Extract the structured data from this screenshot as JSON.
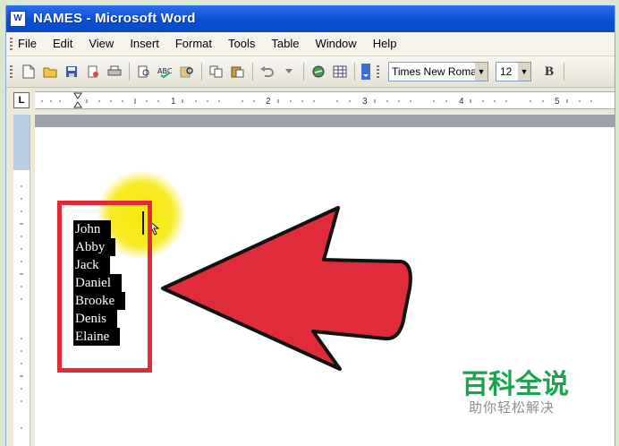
{
  "window": {
    "title": "NAMES - Microsoft Word",
    "app_icon": "W"
  },
  "menu": [
    {
      "label": "File"
    },
    {
      "label": "Edit"
    },
    {
      "label": "View"
    },
    {
      "label": "Insert"
    },
    {
      "label": "Format"
    },
    {
      "label": "Tools"
    },
    {
      "label": "Table"
    },
    {
      "label": "Window"
    },
    {
      "label": "Help"
    }
  ],
  "toolbar": {
    "icons": [
      "new-document-icon",
      "open-folder-icon",
      "save-icon",
      "permission-icon",
      "print-icon",
      "print-preview-icon",
      "spelling-icon",
      "research-icon",
      "copy-icon",
      "paste-icon",
      "undo-icon",
      "hyperlink-icon",
      "table-icon"
    ],
    "font_name": "Times New Roman",
    "font_size": "12",
    "bold_label": "B"
  },
  "ruler": {
    "corner_label": "L",
    "labels": [
      "1",
      "2",
      "3",
      "4",
      "5"
    ]
  },
  "document": {
    "selected_names": [
      "John",
      "Abby",
      "Jack",
      "Daniel",
      "Brooke",
      "Denis",
      "Elaine"
    ]
  },
  "annotation": {
    "highlight_color": "#e12a35",
    "arrow_color": "#e02c3a",
    "cursor_glow": "#f6e800"
  },
  "watermark": {
    "title": "百科全说",
    "subtitle": "助你轻松解决"
  }
}
